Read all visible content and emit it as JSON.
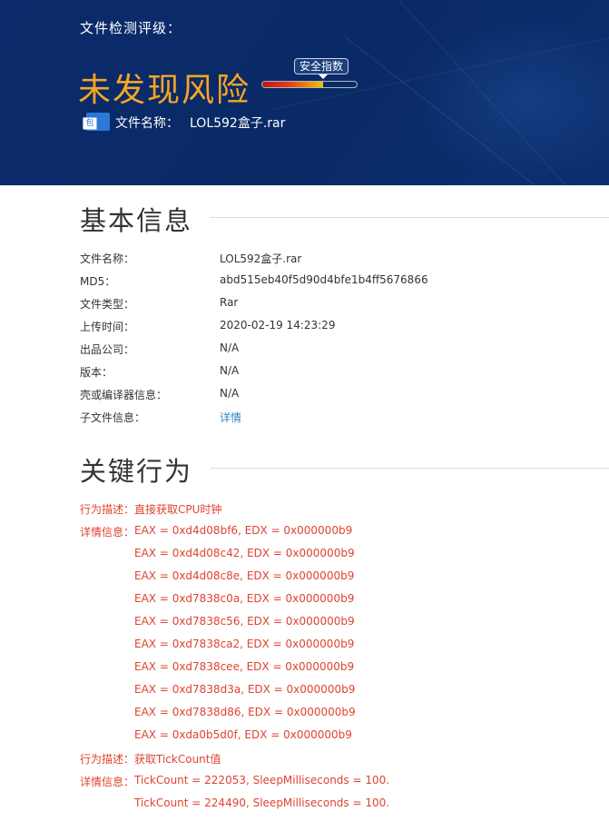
{
  "header": {
    "scan_title": "文件检测评级：",
    "risk_level": "未发现风险",
    "safety_index_label": "安全指数",
    "safety_index_fill": 0.64,
    "file_icon_text": "包",
    "file_label": "文件名称：",
    "file_name": "LOL592盒子.rar"
  },
  "basic_info": {
    "title": "基本信息",
    "rows": [
      {
        "key": "文件名称：",
        "value": "LOL592盒子.rar"
      },
      {
        "key": "MD5：",
        "value": "abd515eb40f5d90d4bfe1b4ff5676866"
      },
      {
        "key": "文件类型：",
        "value": "Rar"
      },
      {
        "key": "上传时间：",
        "value": "2020-02-19 14:23:29"
      },
      {
        "key": "出品公司：",
        "value": "N/A"
      },
      {
        "key": "版本：",
        "value": "N/A"
      },
      {
        "key": "壳或编译器信息：",
        "value": "N/A"
      },
      {
        "key": "子文件信息：",
        "value": "详情"
      }
    ]
  },
  "key_behavior": {
    "title": "关键行为",
    "desc_label": "行为描述：",
    "detail_label": "详情信息：",
    "groups": [
      {
        "desc": "直接获取CPU时钟",
        "details": [
          "EAX = 0xd4d08bf6, EDX = 0x000000b9",
          "EAX = 0xd4d08c42, EDX = 0x000000b9",
          "EAX = 0xd4d08c8e, EDX = 0x000000b9",
          "EAX = 0xd7838c0a, EDX = 0x000000b9",
          "EAX = 0xd7838c56, EDX = 0x000000b9",
          "EAX = 0xd7838ca2, EDX = 0x000000b9",
          "EAX = 0xd7838cee, EDX = 0x000000b9",
          "EAX = 0xd7838d3a, EDX = 0x000000b9",
          "EAX = 0xd7838d86, EDX = 0x000000b9",
          "EAX = 0xda0b5d0f, EDX = 0x000000b9"
        ]
      },
      {
        "desc": "获取TickCount值",
        "details": [
          "TickCount = 222053, SleepMilliseconds = 100.",
          "TickCount = 224490, SleepMilliseconds = 100."
        ]
      }
    ]
  }
}
